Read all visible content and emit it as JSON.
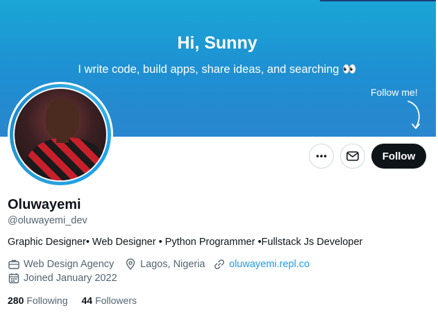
{
  "banner": {
    "greeting": "Hi, Sunny",
    "tagline": "I write code, build apps, share ideas, and searching 👀",
    "follow_me": "Follow me!"
  },
  "profile": {
    "display_name": "Oluwayemi",
    "handle": "@oluwayemi_dev",
    "bio": "Graphic Designer• Web Designer • Python Programmer •Fullstack Js Developer",
    "work": "Web Design Agency",
    "location": "Lagos, Nigeria",
    "website": "oluwayemi.repl.co",
    "joined": "Joined January 2022",
    "following_count": "280",
    "following_label": "Following",
    "followers_count": "44",
    "followers_label": "Followers"
  },
  "actions": {
    "follow_label": "Follow"
  },
  "colors": {
    "accent": "#1d9bf0",
    "button_dark": "#0f1419",
    "muted_text": "#536471"
  }
}
